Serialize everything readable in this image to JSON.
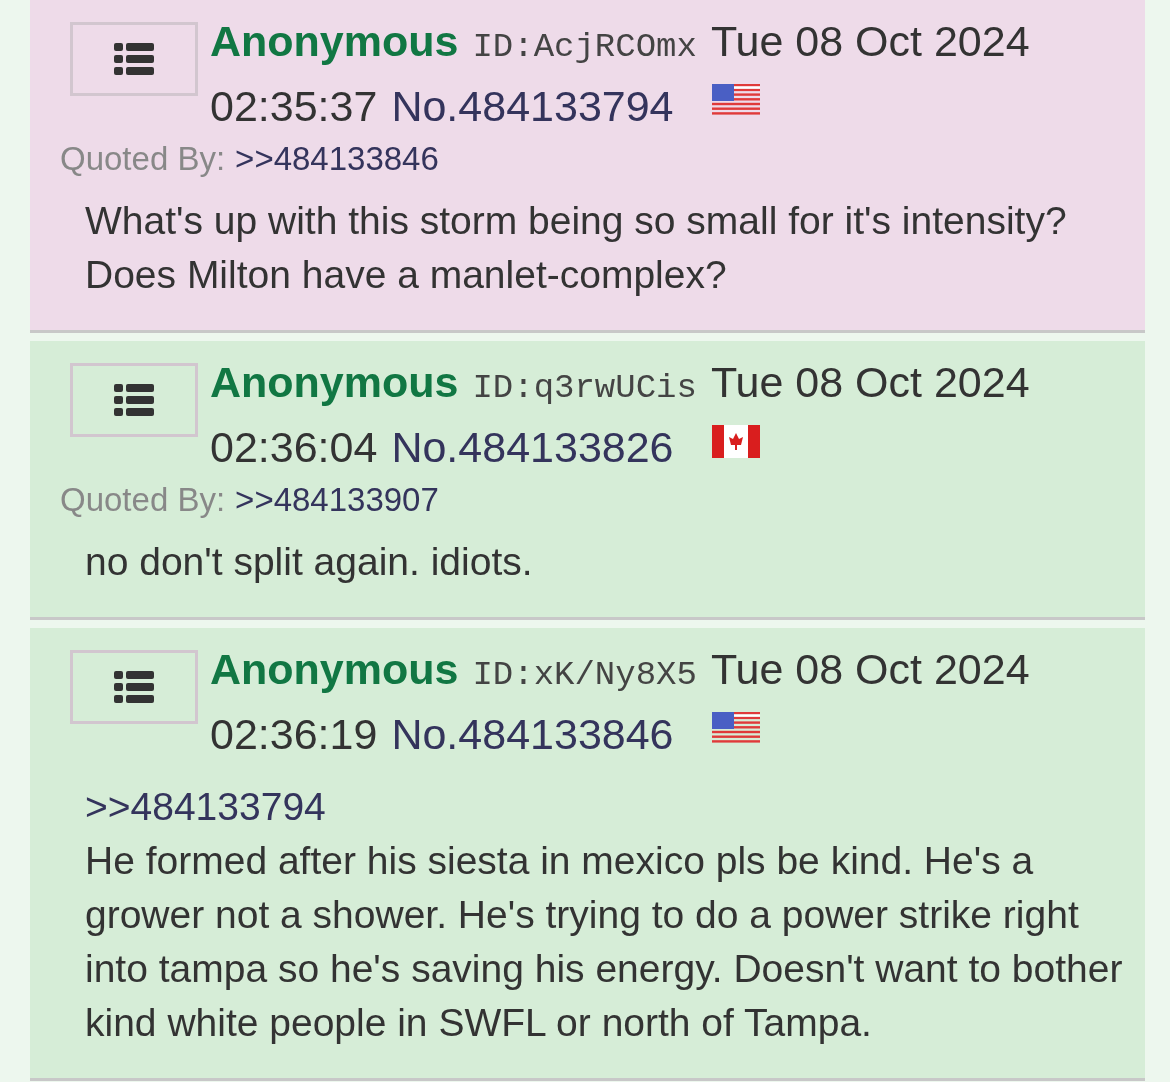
{
  "posts": [
    {
      "highlighted": true,
      "name": "Anonymous",
      "id": "ID:AcjRCOmx",
      "date": "Tue 08 Oct 2024",
      "time": "02:35:37",
      "number": "No.484133794",
      "flag": {
        "kind": "us"
      },
      "quoted_by_label": "Quoted By:",
      "quoted_by": [
        ">>484133846"
      ],
      "body": [
        {
          "kind": "text",
          "text": "What's up with this storm being so small for it's intensity? Does Milton have a manlet-complex?"
        }
      ]
    },
    {
      "highlighted": false,
      "name": "Anonymous",
      "id": "ID:q3rwUCis",
      "date": "Tue 08 Oct 2024",
      "time": "02:36:04",
      "number": "No.484133826",
      "flag": {
        "kind": "ca"
      },
      "quoted_by_label": "Quoted By:",
      "quoted_by": [
        ">>484133907"
      ],
      "body": [
        {
          "kind": "text",
          "text": "no don't split again. idiots."
        }
      ]
    },
    {
      "highlighted": false,
      "name": "Anonymous",
      "id": "ID:xK/Ny8X5",
      "date": "Tue 08 Oct 2024",
      "time": "02:36:19",
      "number": "No.484133846",
      "flag": {
        "kind": "us"
      },
      "body": [
        {
          "kind": "quote",
          "text": ">>484133794"
        },
        {
          "kind": "text",
          "text": "He formed after his siesta in mexico pls be kind. He's a grower not a shower. He's trying to do a power strike right into tampa so he's saving his energy. Doesn't want to bother kind white people in SWFL or north of Tampa."
        }
      ]
    }
  ]
}
